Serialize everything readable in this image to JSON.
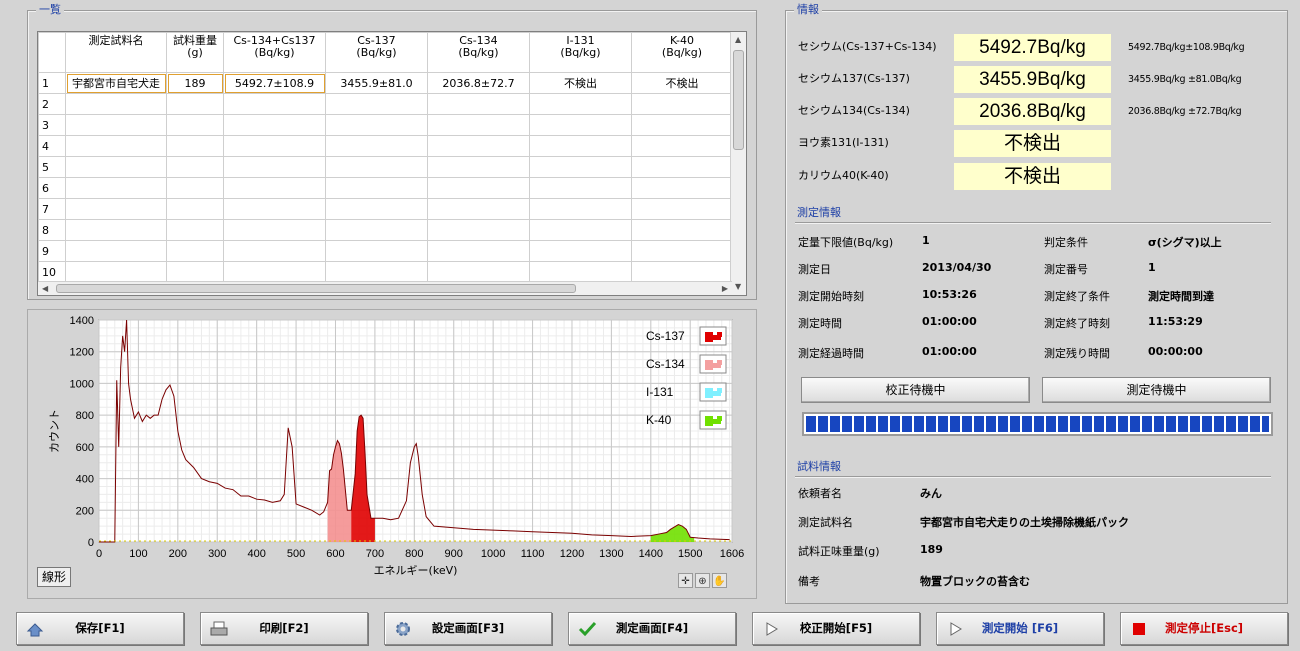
{
  "list_panel": {
    "title": "一覧"
  },
  "table": {
    "columns": [
      {
        "key": "no",
        "label": "",
        "unit": ""
      },
      {
        "key": "name",
        "label": "測定試料名",
        "unit": ""
      },
      {
        "key": "weight",
        "label": "試料重量",
        "unit": "(g)"
      },
      {
        "key": "cs_total",
        "label": "Cs-134+Cs137",
        "unit": "(Bq/kg)"
      },
      {
        "key": "cs137",
        "label": "Cs-137",
        "unit": "(Bq/kg)"
      },
      {
        "key": "cs134",
        "label": "Cs-134",
        "unit": "(Bq/kg)"
      },
      {
        "key": "i131",
        "label": "I-131",
        "unit": "(Bq/kg)"
      },
      {
        "key": "k40",
        "label": "K-40",
        "unit": "(Bq/kg)"
      }
    ],
    "rows": [
      [
        "1",
        "宇都宮市自宅犬走",
        "189",
        "5492.7±108.9",
        "3455.9±81.0",
        "2036.8±72.7",
        "不検出",
        "不検出"
      ],
      [
        "2",
        "",
        "",
        "",
        "",
        "",
        "",
        ""
      ],
      [
        "3",
        "",
        "",
        "",
        "",
        "",
        "",
        ""
      ],
      [
        "4",
        "",
        "",
        "",
        "",
        "",
        "",
        ""
      ],
      [
        "5",
        "",
        "",
        "",
        "",
        "",
        "",
        ""
      ],
      [
        "6",
        "",
        "",
        "",
        "",
        "",
        "",
        ""
      ],
      [
        "7",
        "",
        "",
        "",
        "",
        "",
        "",
        ""
      ],
      [
        "8",
        "",
        "",
        "",
        "",
        "",
        "",
        ""
      ],
      [
        "9",
        "",
        "",
        "",
        "",
        "",
        "",
        ""
      ],
      [
        "10",
        "",
        "",
        "",
        "",
        "",
        "",
        ""
      ]
    ]
  },
  "chart_data": {
    "type": "area",
    "xlabel": "エネルギー(keV)",
    "ylabel": "カウント",
    "xlim": [
      0,
      1606
    ],
    "ylim": [
      0,
      1400
    ],
    "xticks": [
      0,
      100,
      200,
      300,
      400,
      500,
      600,
      700,
      800,
      900,
      1000,
      1100,
      1200,
      1300,
      1400,
      1500,
      1606
    ],
    "yticks": [
      0,
      200,
      400,
      600,
      800,
      1000,
      1200,
      1400
    ],
    "grid": true,
    "legend_position": "top-right",
    "spectrum": {
      "x": [
        0,
        40,
        45,
        50,
        55,
        60,
        65,
        70,
        75,
        80,
        90,
        100,
        110,
        120,
        130,
        140,
        150,
        160,
        170,
        180,
        190,
        200,
        210,
        220,
        240,
        260,
        280,
        300,
        320,
        340,
        360,
        380,
        400,
        420,
        440,
        460,
        470,
        480,
        490,
        500,
        520,
        540,
        560,
        570,
        580,
        585,
        590,
        595,
        600,
        605,
        610,
        615,
        620,
        630,
        640,
        650,
        655,
        660,
        665,
        670,
        675,
        680,
        690,
        700,
        720,
        740,
        760,
        780,
        790,
        800,
        805,
        810,
        820,
        830,
        850,
        900,
        950,
        1000,
        1050,
        1100,
        1150,
        1200,
        1250,
        1300,
        1350,
        1400,
        1420,
        1440,
        1450,
        1460,
        1470,
        1480,
        1490,
        1500,
        1520,
        1550,
        1600
      ],
      "y": [
        0,
        0,
        1020,
        600,
        1100,
        1300,
        1200,
        1400,
        1000,
        900,
        780,
        820,
        760,
        800,
        780,
        800,
        800,
        900,
        960,
        990,
        920,
        700,
        580,
        520,
        470,
        400,
        380,
        370,
        340,
        330,
        290,
        290,
        270,
        265,
        250,
        260,
        300,
        720,
        600,
        240,
        220,
        200,
        170,
        190,
        250,
        450,
        460,
        550,
        600,
        640,
        620,
        560,
        460,
        200,
        200,
        430,
        700,
        790,
        800,
        780,
        560,
        300,
        150,
        150,
        150,
        140,
        150,
        260,
        500,
        600,
        620,
        540,
        300,
        160,
        100,
        90,
        80,
        75,
        70,
        65,
        60,
        55,
        45,
        40,
        35,
        40,
        50,
        60,
        80,
        95,
        110,
        100,
        80,
        30,
        25,
        20,
        15
      ]
    },
    "legend": [
      {
        "name": "Cs-137",
        "color": "#e00000"
      },
      {
        "name": "Cs-134",
        "color": "#f4a0a0"
      },
      {
        "name": "I-131",
        "color": "#80f0ff"
      },
      {
        "name": "K-40",
        "color": "#70e000"
      }
    ],
    "highlight_regions": [
      {
        "name": "Cs-134",
        "color": "#f49090",
        "x": [
          580,
          640
        ],
        "baseline": 170
      },
      {
        "name": "Cs-137",
        "color": "#e00000",
        "x": [
          640,
          700
        ],
        "baseline": 0
      },
      {
        "name": "K-40",
        "color": "#70e000",
        "x": [
          1400,
          1510
        ],
        "baseline": 0
      }
    ]
  },
  "chart_controls": {
    "mode_label": "線形"
  },
  "info_panel": {
    "title": "情報",
    "nuclides": [
      {
        "label": "セシウム(Cs-137+Cs-134)",
        "value": "5492.7Bq/kg",
        "detail": "5492.7Bq/kg±108.9Bq/kg"
      },
      {
        "label": "セシウム137(Cs-137)",
        "value": "3455.9Bq/kg",
        "detail": "3455.9Bq/kg ±81.0Bq/kg"
      },
      {
        "label": "セシウム134(Cs-134)",
        "value": "2036.8Bq/kg",
        "detail": "2036.8Bq/kg ±72.7Bq/kg"
      },
      {
        "label": "ヨウ素131(I-131)",
        "value": "不検出",
        "detail": ""
      },
      {
        "label": "カリウム40(K-40)",
        "value": "不検出",
        "detail": ""
      }
    ]
  },
  "measure_info": {
    "title": "測定情報",
    "left": [
      {
        "label": "定量下限値(Bq/kg)",
        "value": "1"
      },
      {
        "label": "測定日",
        "value": "2013/04/30"
      },
      {
        "label": "測定開始時刻",
        "value": "10:53:26"
      },
      {
        "label": "測定時間",
        "value": "01:00:00"
      },
      {
        "label": "測定経過時間",
        "value": "01:00:00"
      }
    ],
    "right": [
      {
        "label": "判定条件",
        "value": "σ(シグマ)以上"
      },
      {
        "label": "測定番号",
        "value": "1"
      },
      {
        "label": "測定終了条件",
        "value": "測定時間到達"
      },
      {
        "label": "測定終了時刻",
        "value": "11:53:29"
      },
      {
        "label": "測定残り時間",
        "value": "00:00:00"
      }
    ],
    "calibration_status": "校正待機中",
    "measure_status": "測定待機中",
    "progress": 1.0
  },
  "sample_info": {
    "title": "試料情報",
    "rows": [
      {
        "label": "依頼者名",
        "value": "みん"
      },
      {
        "label": "測定試料名",
        "value": "宇都宮市自宅犬走りの土埃掃除機紙パック"
      },
      {
        "label": "試料正味重量(g)",
        "value": "189"
      },
      {
        "label": "備考",
        "value": "物置ブロックの苔含む"
      }
    ]
  },
  "toolbar": {
    "buttons": [
      {
        "label": "保存[F1]",
        "icon": "save-icon"
      },
      {
        "label": "印刷[F2]",
        "icon": "print-icon"
      },
      {
        "label": "設定画面[F3]",
        "icon": "gear-icon"
      },
      {
        "label": "測定画面[F4]",
        "icon": "check-icon"
      },
      {
        "label": "校正開始[F5]",
        "icon": "play-icon"
      },
      {
        "label": "測定開始 [F6]",
        "icon": "play-icon",
        "color": "#1d3fa6"
      },
      {
        "label": "測定停止[Esc]",
        "icon": "stop-icon",
        "color": "#cc0000"
      }
    ]
  }
}
